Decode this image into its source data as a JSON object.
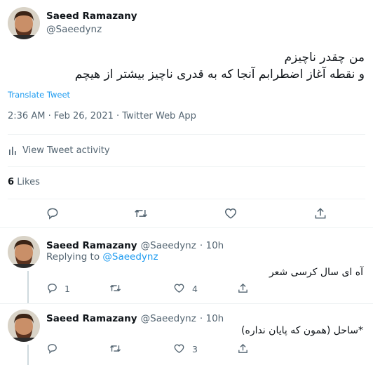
{
  "main_tweet": {
    "author_name": "Saeed Ramazany",
    "author_handle": "@Saeedynz",
    "text_line1": "من چقدر ناچیزم",
    "text_line2": "و نقطه آغاز اضطرابم آنجا که به قدری ناچیز بیشتر از هیچم",
    "translate_label": "Translate Tweet",
    "timestamp": "2:36 AM · Feb 26, 2021 · Twitter Web App",
    "activity_label": "View Tweet activity",
    "likes_count": "6",
    "likes_label": "Likes",
    "actions": [
      "reply-icon",
      "retweet-icon",
      "like-icon",
      "share-icon"
    ]
  },
  "replies": [
    {
      "author_name": "Saeed Ramazany",
      "author_handle": "@Saeedynz",
      "time": "· 10h",
      "replying_prefix": "Replying to",
      "replying_handle": "@Saeedynz",
      "text": "آه ای سال کرسی شعر",
      "reply_count": "1",
      "retweet_count": "",
      "like_count": "4"
    },
    {
      "author_name": "Saeed Ramazany",
      "author_handle": "@Saeedynz",
      "time": "· 10h",
      "text": "*ساحل (همون که پایان نداره)",
      "reply_count": "",
      "retweet_count": "",
      "like_count": "3"
    }
  ],
  "colors": {
    "link": "#1d9bf0",
    "secondary": "#536471",
    "separator": "#eff3f4",
    "thread_line": "#cfd9de"
  }
}
